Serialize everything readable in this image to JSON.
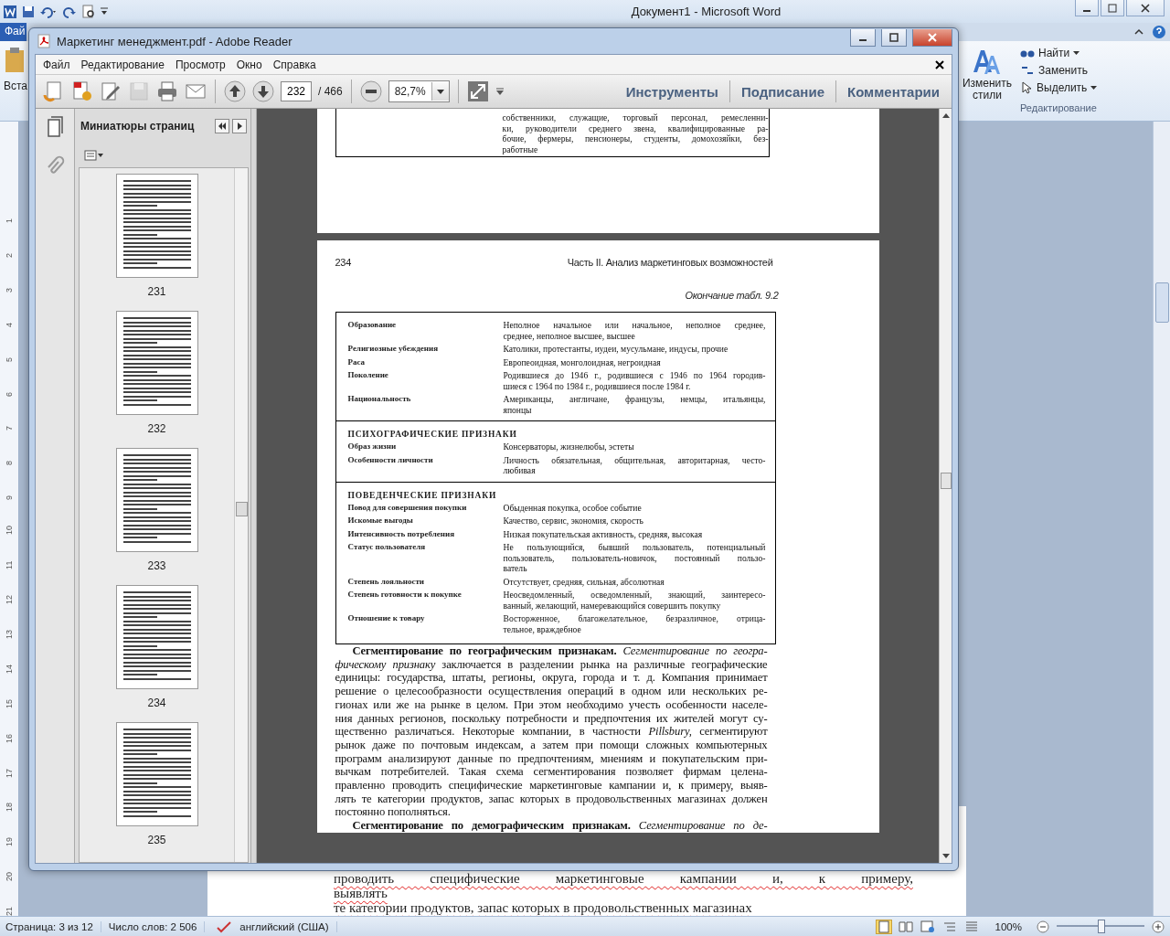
{
  "word": {
    "title": "Документ1  -  Microsoft Word",
    "file_tab": "Фай",
    "paste_label": "Вста",
    "ribbon": {
      "change_styles": "Изменить стили",
      "find": "Найти",
      "replace": "Заменить",
      "select": "Выделить",
      "group_label": "Редактирование"
    },
    "ruler_numbers": [
      "1",
      "2",
      "3",
      "4",
      "5",
      "6",
      "7",
      "8",
      "9",
      "10",
      "11",
      "12",
      "13",
      "14",
      "15",
      "16",
      "17",
      "18",
      "19",
      "20",
      "21"
    ],
    "document_lines": [
      "проводить специфические маркетинговые кампании и, к примеру,",
      "выявлять",
      "те категории продуктов, запас которых в продовольственных магазинах"
    ],
    "status_bar": {
      "page": "Страница: 3 из 12",
      "words": "Число слов: 2 506",
      "language": "английский (США)",
      "zoom": "100%",
      "zoom_slider": {
        "level": 0.5
      }
    }
  },
  "reader": {
    "title": "Маркетинг менеджмент.pdf - Adobe Reader",
    "menu": [
      "Файл",
      "Редактирование",
      "Просмотр",
      "Окно",
      "Справка"
    ],
    "page_input": "232",
    "page_total": "/ 466",
    "zoom": "82,7%",
    "panel_tabs": [
      "Инструменты",
      "Подписание",
      "Комментарии"
    ],
    "sidebar": {
      "title": "Миниатюры страниц",
      "thumbnails": [
        "231",
        "232",
        "233",
        "234",
        "235"
      ]
    },
    "previous_page": {
      "table_fragment": [
        "собственники, служащие, торговый персонал, ремесленни-",
        "ки, руководители среднего звена, квалифицированные ра-",
        "бочие, фермеры, пенсионеры, студенты, домохозяйки, без-",
        "работные"
      ]
    },
    "page": {
      "number": "234",
      "running_head": "Часть II. Анализ маркетинговых возможностей",
      "table_caption": "Окончание табл. 9.2",
      "table": [
        {
          "rows": [
            {
              "label": "Образование",
              "lines": [
                "Неполное начальное или начальное, неполное среднее,",
                "среднее, неполное высшее, высшее"
              ]
            },
            {
              "label": "Религиозные убеждения",
              "lines": [
                "Католики, протестанты, иудеи, мусульмане, индусы, прочие"
              ]
            },
            {
              "label": "Раса",
              "lines": [
                "Европеоидная, монголоидная, негроидная"
              ]
            },
            {
              "label": "Поколение",
              "lines": [
                "Родившиеся до 1946 г., родившиеся с 1946 по 1964 городив-",
                "шиеся с 1964 по 1984 г., родившиеся после 1984 г."
              ]
            },
            {
              "label": "Национальность",
              "lines": [
                "Американцы, англичане, французы, немцы, итальянцы,",
                "японцы"
              ]
            }
          ]
        },
        {
          "heading": "ПСИХОГРАФИЧЕСКИЕ ПРИЗНАКИ",
          "rows": [
            {
              "label": "Образ жизни",
              "lines": [
                "Консерваторы, жизнелюбы, эстеты"
              ]
            },
            {
              "label": "Особенности личности",
              "lines": [
                "Личность обязательная, общительная, авторитарная, често-",
                "любивая"
              ]
            }
          ]
        },
        {
          "heading": "ПОВЕДЕНЧЕСКИЕ ПРИЗНАКИ",
          "rows": [
            {
              "label": "Повод для совершения покупки",
              "lines": [
                "Обыденная покупка, особое событие"
              ]
            },
            {
              "label": "Искомые выгоды",
              "lines": [
                "Качество, сервис, экономия, скорость"
              ]
            },
            {
              "label": "Интенсивность потребления",
              "lines": [
                "Низкая покупательская активность, средняя, высокая"
              ]
            },
            {
              "label": "Статус пользователя",
              "lines": [
                "Не пользующийся, бывший пользователь, потенциальный",
                "пользователь, пользователь-новичок, постоянный пользо-",
                "ватель"
              ]
            },
            {
              "label": "Степень лояльности",
              "lines": [
                "Отсутствует, средняя, сильная, абсолютная"
              ]
            },
            {
              "label": "Степень готовности к покупке",
              "lines": [
                "Неосведомленный, осведомленный, знающий, заинтересо-",
                "ванный, желающий, намеревающийся совершить покупку"
              ]
            },
            {
              "label": "Отношение к товару",
              "lines": [
                "Восторженное, благожелательное, безразличное, отрица-",
                "тельное, враждебное"
              ]
            }
          ]
        }
      ],
      "paragraphs": [
        {
          "lines": [
            "**Сегментирование по географическим признакам.** *Сегментирование по геогра-*",
            "*фическому признаку* заключается в разделении рынка на различные географические",
            "единицы: государства, штаты, регионы, округа, города и т. д. Компания принимает",
            "решение о целесообразности осуществления операций в одном или нескольких ре-",
            "гионах или же на рынке в целом. При этом необходимо учесть особенности населе-",
            "ния данных регионов, поскольку потребности и предпочтения их жителей могут су-",
            "щественно различаться. Некоторые компании, в частности *Pillsbury,* сегментируют",
            "рынок даже по почтовым индексам, а затем при помощи сложных компьютерных",
            "программ анализируют данные по предпочтениям, мнениям и покупательским при-",
            "вычкам потребителей. Такая схема сегментирования позволяет фирмам целена-",
            "правленно проводить специфические маркетинговые кампании и, к примеру, выяв-",
            "лять те категории продуктов, запас которых в продовольственных магазинах должен",
            "постоянно пополняться."
          ]
        },
        {
          "lines": [
            "**Сегментирование по демографическим признакам.** *Сегментирование по де-*"
          ]
        }
      ]
    }
  }
}
